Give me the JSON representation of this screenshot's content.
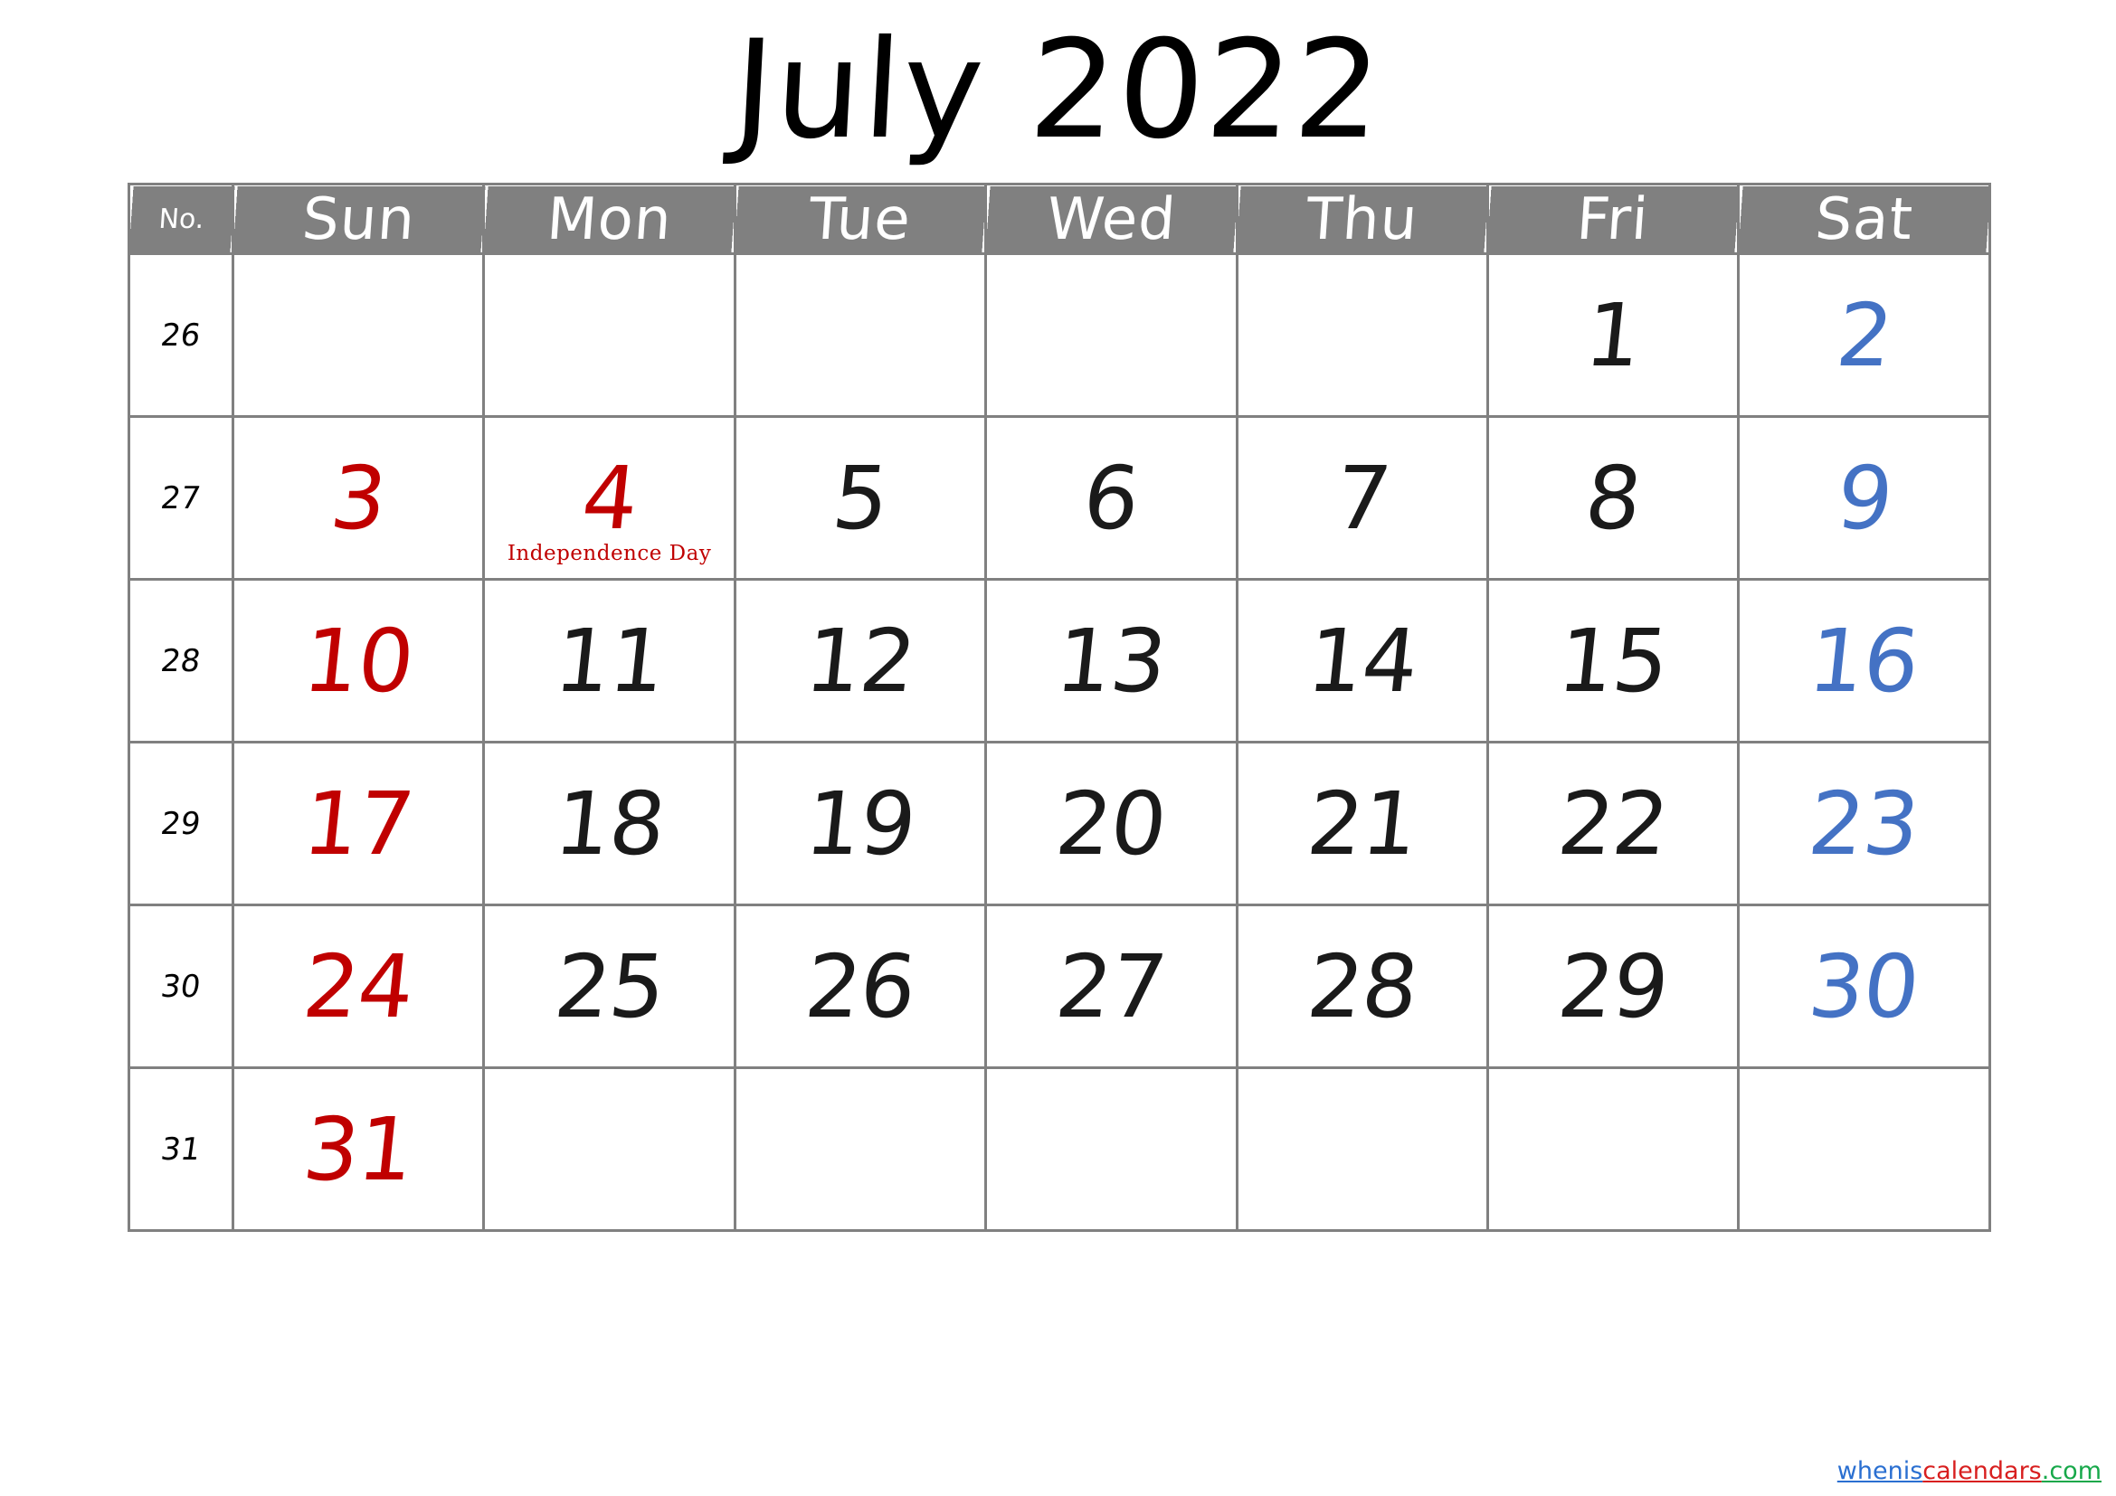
{
  "title": "July 2022",
  "colors": {
    "header_bg": "#808080",
    "grid": "#808080",
    "sunday": "#C00000",
    "saturday": "#4472C4",
    "weekday": "#1A1A1A",
    "holiday": "#C00000",
    "watermark_blue": "#2A6FD1",
    "watermark_red": "#D81F1F",
    "watermark_green": "#17A84A"
  },
  "header": {
    "weeknum_label": "No.",
    "days": [
      "Sun",
      "Mon",
      "Tue",
      "Wed",
      "Thu",
      "Fri",
      "Sat"
    ]
  },
  "weeks": [
    {
      "number": "26",
      "days": [
        {
          "date": "",
          "type": "empty"
        },
        {
          "date": "",
          "type": "empty"
        },
        {
          "date": "",
          "type": "empty"
        },
        {
          "date": "",
          "type": "empty"
        },
        {
          "date": "",
          "type": "empty"
        },
        {
          "date": "1",
          "type": "weekday"
        },
        {
          "date": "2",
          "type": "saturday"
        }
      ]
    },
    {
      "number": "27",
      "days": [
        {
          "date": "3",
          "type": "sunday"
        },
        {
          "date": "4",
          "type": "holiday",
          "event": "Independence Day"
        },
        {
          "date": "5",
          "type": "weekday"
        },
        {
          "date": "6",
          "type": "weekday"
        },
        {
          "date": "7",
          "type": "weekday"
        },
        {
          "date": "8",
          "type": "weekday"
        },
        {
          "date": "9",
          "type": "saturday"
        }
      ]
    },
    {
      "number": "28",
      "days": [
        {
          "date": "10",
          "type": "sunday"
        },
        {
          "date": "11",
          "type": "weekday"
        },
        {
          "date": "12",
          "type": "weekday"
        },
        {
          "date": "13",
          "type": "weekday"
        },
        {
          "date": "14",
          "type": "weekday"
        },
        {
          "date": "15",
          "type": "weekday"
        },
        {
          "date": "16",
          "type": "saturday"
        }
      ]
    },
    {
      "number": "29",
      "days": [
        {
          "date": "17",
          "type": "sunday"
        },
        {
          "date": "18",
          "type": "weekday"
        },
        {
          "date": "19",
          "type": "weekday"
        },
        {
          "date": "20",
          "type": "weekday"
        },
        {
          "date": "21",
          "type": "weekday"
        },
        {
          "date": "22",
          "type": "weekday"
        },
        {
          "date": "23",
          "type": "saturday"
        }
      ]
    },
    {
      "number": "30",
      "days": [
        {
          "date": "24",
          "type": "sunday"
        },
        {
          "date": "25",
          "type": "weekday"
        },
        {
          "date": "26",
          "type": "weekday"
        },
        {
          "date": "27",
          "type": "weekday"
        },
        {
          "date": "28",
          "type": "weekday"
        },
        {
          "date": "29",
          "type": "weekday"
        },
        {
          "date": "30",
          "type": "saturday"
        }
      ]
    },
    {
      "number": "31",
      "days": [
        {
          "date": "31",
          "type": "sunday"
        },
        {
          "date": "",
          "type": "empty"
        },
        {
          "date": "",
          "type": "empty"
        },
        {
          "date": "",
          "type": "empty"
        },
        {
          "date": "",
          "type": "empty"
        },
        {
          "date": "",
          "type": "empty"
        },
        {
          "date": "",
          "type": "empty"
        }
      ]
    }
  ],
  "watermark": {
    "part1": "whenis",
    "part2": "calendars",
    "part3": ".com"
  }
}
